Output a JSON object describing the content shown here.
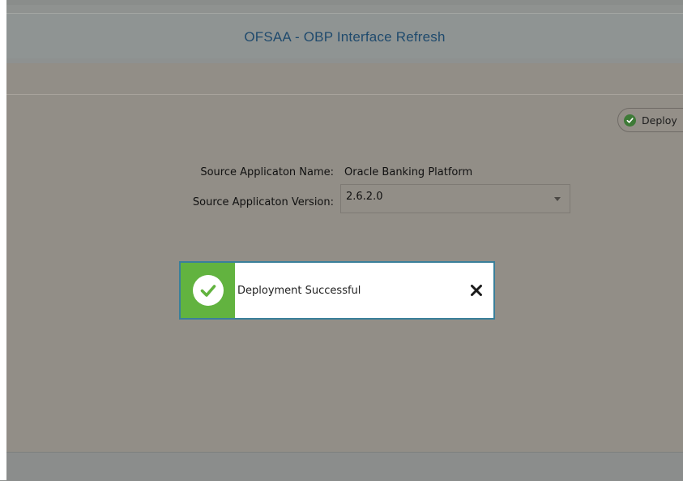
{
  "header": {
    "title": "OFSAA - OBP Interface Refresh"
  },
  "actions": {
    "deploy_label": "Deploy"
  },
  "form": {
    "source_name_label": "Source Applicaton Name:",
    "source_name_value": "Oracle Banking Platform",
    "source_version_label": "Source Applicaton Version:",
    "source_version_value": "2.6.2.0"
  },
  "toast": {
    "message": "Deployment Successful"
  },
  "icons": {
    "deploy": "check-circle-icon",
    "toast": "check-circle-icon",
    "close": "close-icon",
    "dropdown": "chevron-down-icon"
  },
  "colors": {
    "success_green": "#62b33f",
    "header_text": "#1f4a6d",
    "toast_border": "#3a7f9a"
  }
}
